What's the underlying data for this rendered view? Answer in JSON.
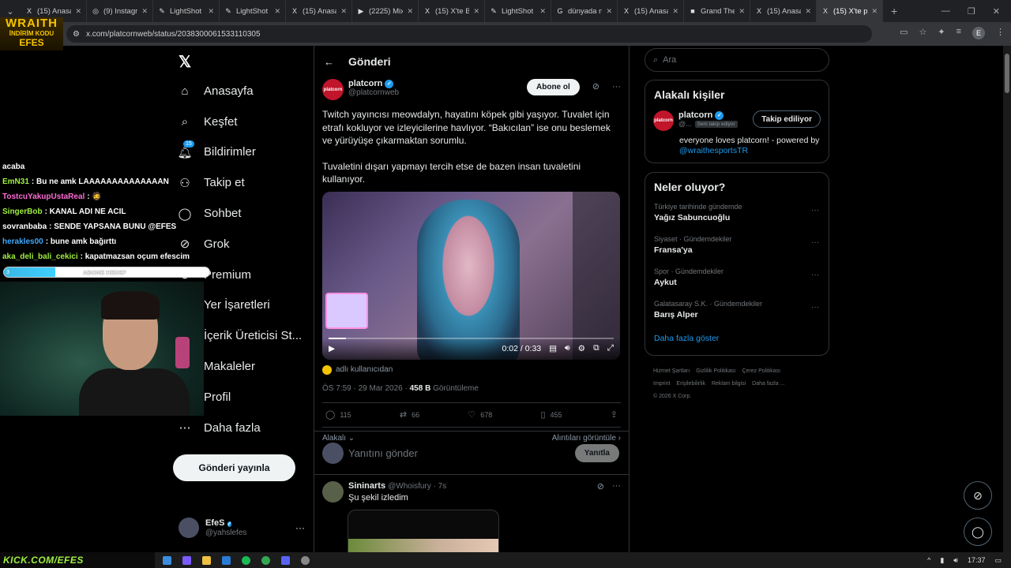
{
  "browser": {
    "tabs": [
      {
        "icon": "x-icon",
        "glyph": "X",
        "title": "(15) Anasayfa"
      },
      {
        "icon": "instagram-icon",
        "glyph": "◎",
        "title": "(9) Instagram"
      },
      {
        "icon": "lightshot-icon",
        "glyph": "✎",
        "title": "LightShot"
      },
      {
        "icon": "lightshot-icon",
        "glyph": "✎",
        "title": "LightShot"
      },
      {
        "icon": "x-icon",
        "glyph": "X",
        "title": "(15) Anasayfa"
      },
      {
        "icon": "youtube-icon",
        "glyph": "▶",
        "title": "(2225) Mix"
      },
      {
        "icon": "x-icon",
        "glyph": "X",
        "title": "(15) X'te B"
      },
      {
        "icon": "lightshot-icon",
        "glyph": "✎",
        "title": "LightShot"
      },
      {
        "icon": "google-icon",
        "glyph": "G",
        "title": "dünyada n"
      },
      {
        "icon": "x-icon",
        "glyph": "X",
        "title": "(15) Anasayfa"
      },
      {
        "icon": "gta-icon",
        "glyph": "■",
        "title": "Grand The"
      },
      {
        "icon": "x-icon",
        "glyph": "X",
        "title": "(15) Anasayfa"
      },
      {
        "icon": "x-icon",
        "glyph": "X",
        "title": "(15) X'te p"
      }
    ],
    "url": "x.com/platcornweb/status/2038300061533110305",
    "profile_initial": "E"
  },
  "overlay": {
    "logo_line1": "WRAITH",
    "logo_line2": "İNDİRİM KODU",
    "logo_line3": "EFES",
    "chat": [
      {
        "user": "acaba",
        "msg": "",
        "color": "#ffffff"
      },
      {
        "user": "EmN31",
        "msg": ": Bu ne amk LAAAAAAAAAAAAAAN",
        "color": "#9fef3f"
      },
      {
        "user": "TostcuYakupUstaReal",
        "msg": ": 🧔",
        "color": "#ff6ad5"
      },
      {
        "user": "SingerBob",
        "msg": ": KANAL ADI NE ACIL",
        "color": "#9fef3f"
      },
      {
        "user": "sovranbaba",
        "msg": ": SENDE YAPSANA BUNU @EFES",
        "color": "#ffffff"
      },
      {
        "user": "herakles00",
        "msg": ": bune amk bağırttı",
        "color": "#3fa9ff"
      },
      {
        "user": "aka_deli_bali_cekici",
        "msg": ": kapatmazsan oçum efescim",
        "color": "#9fef3f"
      }
    ],
    "goal_number": "3",
    "goal_label": "ABONE HEDEF",
    "goal_progress": 0.25,
    "taskbar_banner": "KICK.COM/EFES",
    "clock": "17:37"
  },
  "nav": {
    "items": [
      {
        "name": "nav-home",
        "icon": "home-icon",
        "glyph": "⌂",
        "label": "Anasayfa"
      },
      {
        "name": "nav-explore",
        "icon": "search-icon",
        "glyph": "⌕",
        "label": "Keşfet"
      },
      {
        "name": "nav-notifications",
        "icon": "bell-icon",
        "glyph": "🔔︎",
        "label": "Bildirimler",
        "badge": "15"
      },
      {
        "name": "nav-follow",
        "icon": "add-user-icon",
        "glyph": "⚇",
        "label": "Takip et"
      },
      {
        "name": "nav-chat",
        "icon": "chat-icon",
        "glyph": "◯",
        "label": "Sohbet"
      },
      {
        "name": "nav-grok",
        "icon": "grok-icon",
        "glyph": "⊘",
        "label": "Grok"
      },
      {
        "name": "nav-premium",
        "icon": "premium-icon",
        "glyph": "✪",
        "label": "Premium"
      },
      {
        "name": "nav-bookmarks",
        "icon": "bookmark-icon",
        "glyph": "▯",
        "label": "Yer İşaretleri"
      },
      {
        "name": "nav-creator-studio",
        "icon": "creator-icon",
        "glyph": "⚡",
        "label": "İçerik Üreticisi St..."
      },
      {
        "name": "nav-articles",
        "icon": "article-icon",
        "glyph": "☰",
        "label": "Makaleler"
      },
      {
        "name": "nav-profile",
        "icon": "profile-icon",
        "glyph": "☺",
        "label": "Profil"
      },
      {
        "name": "nav-more",
        "icon": "more-icon",
        "glyph": "⋯",
        "label": "Daha fazla"
      }
    ],
    "post_button": "Gönderi yayınla",
    "me": {
      "name": "EfeS",
      "handle": "@yahslefes"
    }
  },
  "main": {
    "header_title": "Gönderi",
    "post": {
      "author_name": "platcorn",
      "author_handle": "@platcornweb",
      "avatar_text": "platcorn",
      "follow_label": "Abone ol",
      "text_p1": "Twitch yayıncısı meowdalyn, hayatını köpek gibi yaşıyor. Tuvalet için etrafı kokluyor ve izleyicilerine havlıyor. “Bakıcılan” ise onu beslemek ve yürüyüşe çıkarmaktan sorumlu.",
      "text_p2": "Tuvaletini dışarı yapmayı tercih etse de bazen insan tuvaletini kullanıyor.",
      "video_time": "0:02 / 0:33",
      "video_progress": 0.06,
      "from_label": "adlı kullanıcıdan",
      "time": "ÖS 7:59 · 29 Mar 2026 · ",
      "views_count": "458 B",
      "views_label": " Görüntüleme",
      "replies": "115",
      "reposts": "66",
      "likes": "678",
      "bookmarks": "455",
      "relevant_label": "Alakalı",
      "quotes_label": "Alıntıları görüntüle"
    },
    "reply_box": {
      "placeholder": "Yanıtını gönder",
      "button": "Yanıtla"
    },
    "reply_post": {
      "name": "Sininarts",
      "handle": "@Whoisfury · 7s",
      "text": "Şu şekil izledim"
    }
  },
  "right": {
    "search_placeholder": "Ara",
    "related_title": "Alakalı kişiler",
    "person": {
      "name": "platcorn",
      "handle": "@...",
      "tag": "Seni takip ediyor",
      "button": "Takip ediliyor",
      "bio": "everyone loves platcorn! - powered by ",
      "bio_link": "@wraithesportsTR"
    },
    "trends_title": "Neler oluyor?",
    "trends": [
      {
        "category": "Türkiye tarihinde gündemde",
        "name": "Yağız Sabuncuoğlu"
      },
      {
        "category": "Siyaset · Gündemdekiler",
        "name": "Fransa'ya"
      },
      {
        "category": "Spor · Gündemdekiler",
        "name": "Aykut"
      },
      {
        "category": "Galatasaray S.K. · Gündemdekiler",
        "name": "Barış Alper"
      }
    ],
    "show_more": "Daha fazla göster",
    "footer": [
      "Hizmet Şartları",
      "Gizlilik Politikası",
      "Çerez Politikası",
      "Imprint",
      "Erişilebilirlik",
      "Reklam bilgisi",
      "Daha fazla ...",
      "© 2026 X Corp."
    ]
  }
}
